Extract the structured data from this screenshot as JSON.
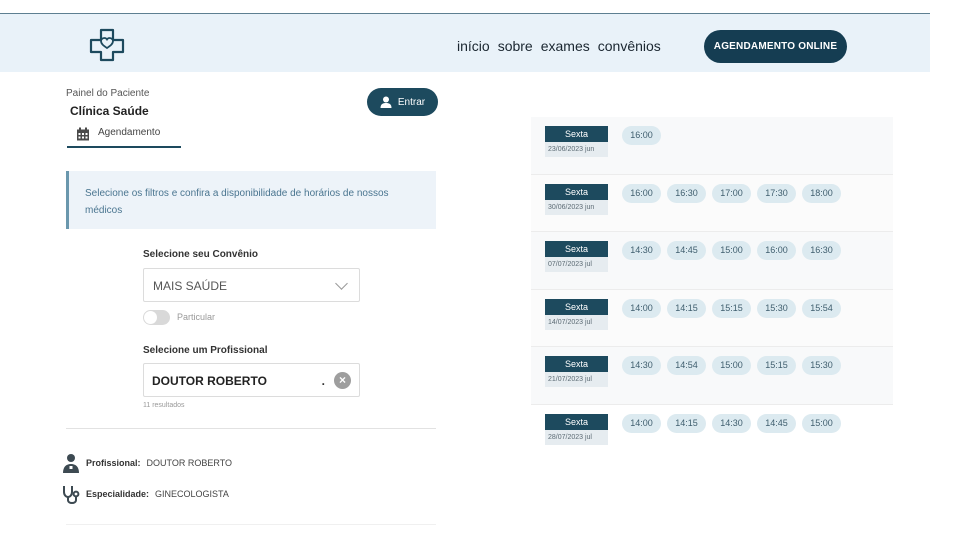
{
  "header": {
    "nav": [
      "início",
      "sobre",
      "exames",
      "convênios"
    ],
    "cta_label": "AGENDAMENTO ONLINE"
  },
  "panel": {
    "subtitle": "Painel do Paciente",
    "clinic": "Clínica Saúde",
    "login_label": "Entrar",
    "tab_label": "Agendamento"
  },
  "info": {
    "text": "Selecione os filtros e confira a disponibilidade de horários de nossos médicos"
  },
  "filters": {
    "convenio_label": "Selecione seu Convênio",
    "convenio_value": "MAIS SAÚDE",
    "particular_label": "Particular",
    "profissional_label": "Selecione um Profissional",
    "profissional_value": "DOUTOR ROBERTO",
    "results_text": "11 resultados"
  },
  "details": {
    "profissional_key": "Profissional:",
    "profissional_value": "DOUTOR ROBERTO",
    "especialidade_key": "Especialidade:",
    "especialidade_value": "GINECOLOGISTA"
  },
  "schedule": [
    {
      "day": "Sexta",
      "date": "23/06/2023 jun",
      "slots": [
        "16:00"
      ]
    },
    {
      "day": "Sexta",
      "date": "30/06/2023 jun",
      "slots": [
        "16:00",
        "16:30",
        "17:00",
        "17:30",
        "18:00"
      ]
    },
    {
      "day": "Sexta",
      "date": "07/07/2023 jul",
      "slots": [
        "14:30",
        "14:45",
        "15:00",
        "16:00",
        "16:30"
      ]
    },
    {
      "day": "Sexta",
      "date": "14/07/2023 jul",
      "slots": [
        "14:00",
        "14:15",
        "15:15",
        "15:30",
        "15:54"
      ]
    },
    {
      "day": "Sexta",
      "date": "21/07/2023 jul",
      "slots": [
        "14:30",
        "14:54",
        "15:00",
        "15:15",
        "15:30"
      ]
    },
    {
      "day": "Sexta",
      "date": "28/07/2023 jul",
      "slots": [
        "14:00",
        "14:15",
        "14:30",
        "14:45",
        "15:00"
      ]
    }
  ],
  "colors": {
    "primary": "#1d4a5e",
    "header_bg": "#e9f2f9",
    "slot_bg": "#dceaf0"
  },
  "icons": [
    "heart-cross-logo-icon",
    "user-icon",
    "calendar-icon",
    "chevron-down-icon",
    "clear-icon",
    "doctor-icon",
    "stethoscope-icon"
  ]
}
